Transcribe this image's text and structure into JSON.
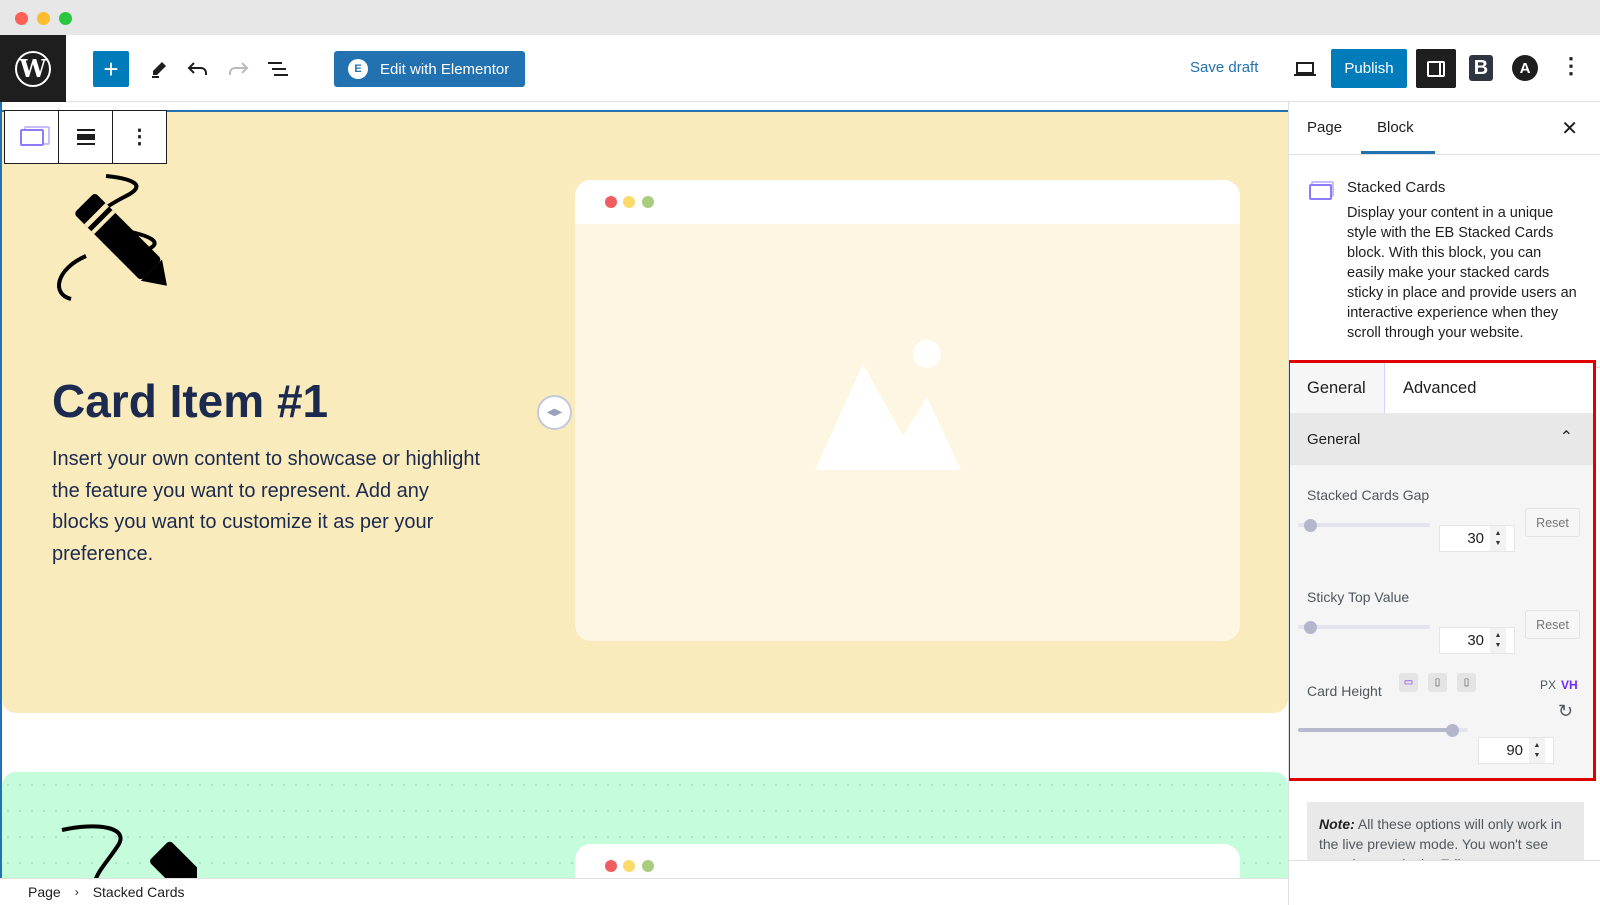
{
  "window": {
    "traffic_lights": [
      "close",
      "minimize",
      "zoom"
    ]
  },
  "toolbar": {
    "logo": "wordpress-logo",
    "logo_glyph": "W",
    "add_block_label": "+",
    "edit_with_elementor_label": "Edit with Elementor",
    "elementor_glyph": "E",
    "save_draft_label": "Save draft",
    "publish_label": "Publish",
    "eb_glyph": "B",
    "astra_glyph": "A",
    "more_glyph": "⋮"
  },
  "block_toolbar": {
    "items": [
      "stacked-cards-block-type",
      "align",
      "options"
    ],
    "kebab": "⋮"
  },
  "canvas": {
    "card1": {
      "title": "Card Item #1",
      "text": "Insert your own content to showcase or highlight the feature you want to represent. Add any blocks you want to customize it as per your preference.",
      "background": "#faebbc",
      "mock_dots": [
        "#f05d5e",
        "#fbd96b",
        "#a8cd7e"
      ]
    },
    "card2": {
      "background": "#c5fcdb"
    }
  },
  "breadcrumb": {
    "items": [
      "Page",
      "Stacked Cards"
    ],
    "separator": "›"
  },
  "sidebar": {
    "tabs": [
      {
        "label": "Page",
        "active": false
      },
      {
        "label": "Block",
        "active": true
      }
    ],
    "close_glyph": "✕",
    "block": {
      "title": "Stacked Cards",
      "description": "Display your content in a unique style with the EB Stacked Cards block. With this block, you can easily make your stacked cards sticky in place and provide users an interactive experience when they scroll through your website."
    },
    "panel": {
      "tabs": [
        {
          "label": "General",
          "active": true
        },
        {
          "label": "Advanced",
          "active": false
        }
      ],
      "section": {
        "title": "General",
        "expanded": true,
        "chevron": "⌃"
      },
      "controls": {
        "stacked_cards_gap": {
          "label": "Stacked Cards Gap",
          "value": "30",
          "slider_fraction": 0.05,
          "reset_label": "Reset"
        },
        "sticky_top_value": {
          "label": "Sticky Top Value",
          "value": "30",
          "slider_fraction": 0.05,
          "reset_label": "Reset"
        },
        "card_height": {
          "label": "Card Height",
          "devices": [
            "desktop",
            "tablet",
            "mobile"
          ],
          "active_device": "desktop",
          "units": [
            "PX",
            "VH"
          ],
          "active_unit": "VH",
          "value": "90",
          "slider_fraction": 0.9,
          "reset_glyph": "↻"
        }
      }
    },
    "note": {
      "label": "Note:",
      "text": "All these options will only work in the live preview mode. You won't see any changes in the Editor."
    }
  },
  "colors": {
    "accent": "#007cba",
    "elementor": "#2271b1",
    "highlight_border": "#e00000",
    "active_device": "#6f2bff"
  }
}
